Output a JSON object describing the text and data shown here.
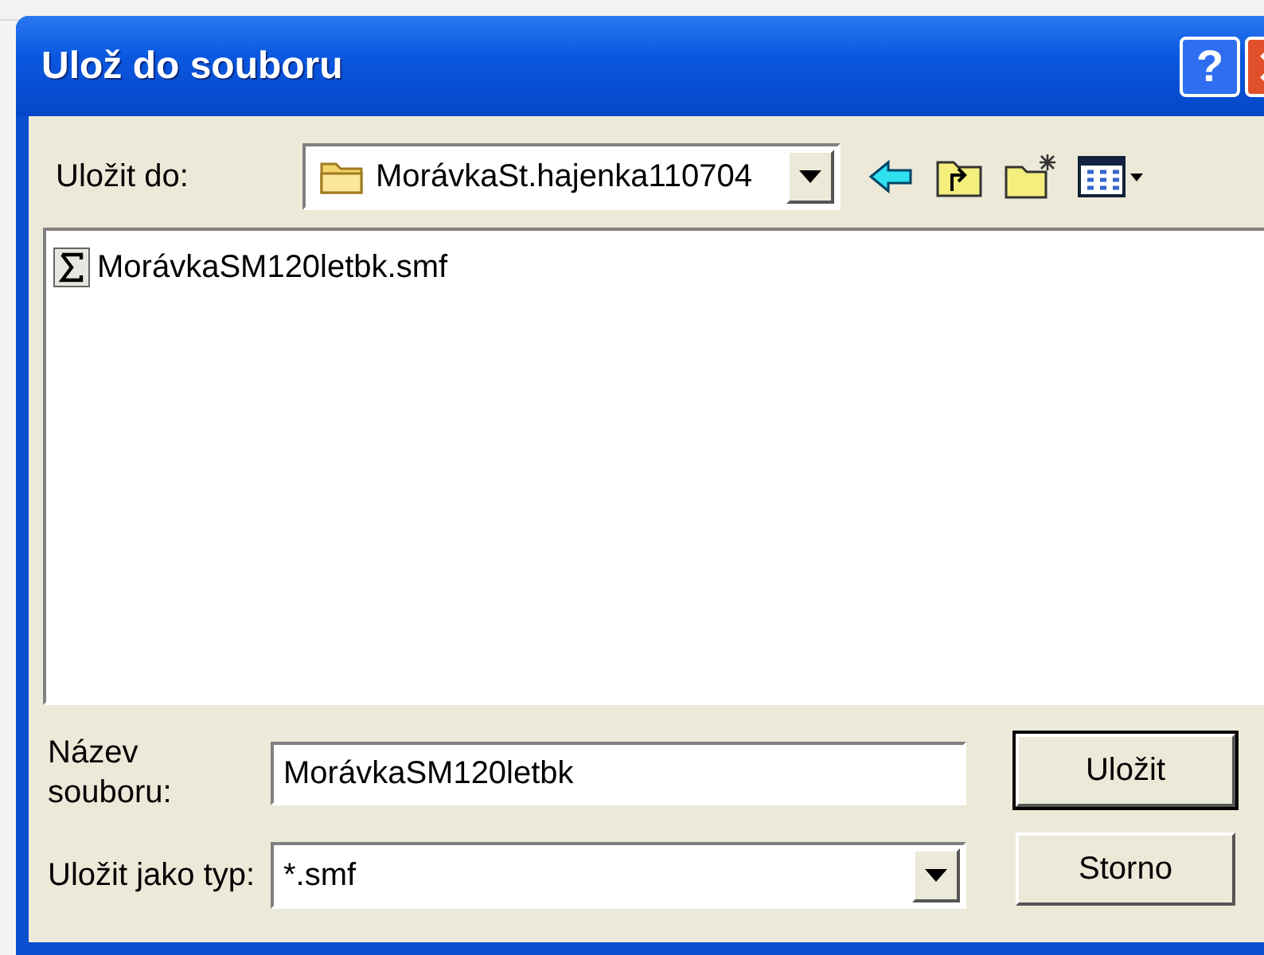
{
  "window": {
    "title": "Ulož do souboru"
  },
  "title_buttons": [
    {
      "kind": "help",
      "label": "?"
    },
    {
      "kind": "close"
    }
  ],
  "save_in": {
    "label": "Uložit do:",
    "value": "MorávkaSt.hajenka110704"
  },
  "files": [
    {
      "name": "MorávkaSM120letbk.smf"
    }
  ],
  "file_name": {
    "label": "Název souboru:",
    "value": "MorávkaSM120letbk"
  },
  "file_type": {
    "label": "Uložit jako typ:",
    "value": "*.smf"
  },
  "buttons": [
    {
      "label": "Uložit",
      "default": true
    },
    {
      "label": "Storno",
      "default": false
    }
  ]
}
